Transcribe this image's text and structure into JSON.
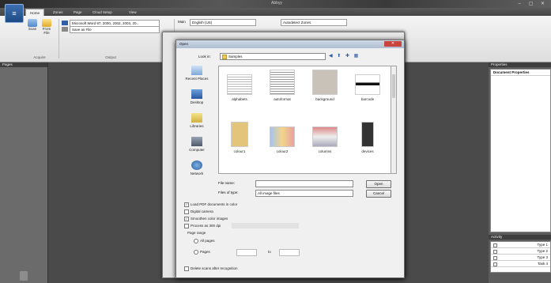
{
  "window": {
    "title": "Abbyy",
    "controls": "–  ▢  ✕"
  },
  "app_logo": "≡",
  "tabs": [
    {
      "label": "Home",
      "active": true
    },
    {
      "label": "Zones",
      "active": false
    },
    {
      "label": "Page",
      "active": false
    },
    {
      "label": "Cloud Setup",
      "active": false
    },
    {
      "label": "View",
      "active": false
    }
  ],
  "ribbon": {
    "scan_label": "Scan",
    "from_file_label": "From File",
    "acquire_label": "Acquire",
    "save_as_format": "Microsoft Word 97, 2000, 2002, 2003, 20..",
    "save_as_file": "Save as File",
    "output_label": "Output",
    "main_label": "Main",
    "main_value": "English (US)",
    "sub_value": "Autodetect Zones"
  },
  "left_panel": {
    "title": "Pages"
  },
  "right_panel": {
    "properties_title": "Properties",
    "document_properties": "Document Properties",
    "activity_title": "Activity",
    "tasks": [
      "Type 1",
      "Type 2",
      "Type 3",
      "Task 4"
    ]
  },
  "dialog": {
    "title": "Open",
    "close": "✕",
    "look_in_label": "Look in:",
    "look_in_value": "Samples",
    "places": [
      "Recent Places",
      "Desktop",
      "Libraries",
      "Computer",
      "Network"
    ],
    "files": [
      "alphabets",
      "autoformat",
      "background",
      "barcode",
      "colour1",
      "colour2",
      "columns",
      "devices"
    ],
    "file_name_label": "File name:",
    "file_name_value": "",
    "files_of_type_label": "Files of type:",
    "files_of_type_value": "All image files",
    "open_button": "Open",
    "cancel_button": "Cancel",
    "options": [
      {
        "label": "Load PDF documents in color",
        "checked": true
      },
      {
        "label": "Digital camera",
        "checked": false
      },
      {
        "label": "Smoothen color images",
        "checked": true
      },
      {
        "label": "Process as 300 dpi",
        "checked": false
      }
    ],
    "page_range_label": "Page range",
    "all_pages": "All pages",
    "pages_label": "Pages",
    "to_label": "to",
    "delete_scans_label": "Delete scans after recognition"
  }
}
